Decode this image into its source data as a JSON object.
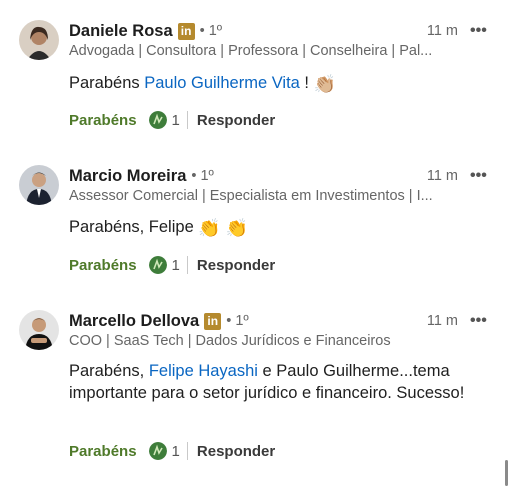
{
  "comments": [
    {
      "name": "Daniele Rosa",
      "degree": "• 1º",
      "time": "11 m",
      "more": "•••",
      "headline": "Advogada | Consultora | Professora | Conselheira | Pal...",
      "text_prefix": "Parabéns ",
      "mention": "Paulo Guilherme Vita",
      "text_suffix": " ! ",
      "emoji": "👏🏼",
      "reaction_label": "Parabéns",
      "reaction_count": "1",
      "reply_label": "Responder"
    },
    {
      "name": "Marcio Moreira",
      "degree": "• 1º",
      "time": "11 m",
      "more": "•••",
      "headline": "Assessor Comercial | Especialista em Investimentos | I...",
      "text_prefix": "Parabéns, Felipe ",
      "emoji": "👏 👏",
      "reaction_label": "Parabéns",
      "reaction_count": "1",
      "reply_label": "Responder"
    },
    {
      "name": "Marcello Dellova",
      "degree": "• 1º",
      "time": "11 m",
      "more": "•••",
      "headline": "COO | SaaS Tech | Dados Jurídicos e Financeiros",
      "text_prefix": "Parabéns, ",
      "mention": "Felipe Hayashi",
      "text_suffix": " e Paulo Guilherme...tema importante para o setor jurídico e financeiro. Sucesso!",
      "reaction_label": "Parabéns",
      "reaction_count": "1",
      "reply_label": "Responder"
    }
  ],
  "linkedin_badge": "in",
  "colors": {
    "mention": "#0a66c2",
    "reaction": "#4f7a2a",
    "badge": "#b58a2e"
  },
  "icons": [
    "linkedin-badge-icon",
    "more-options-icon",
    "celebrate-reaction-icon",
    "clapping-hands-emoji"
  ]
}
